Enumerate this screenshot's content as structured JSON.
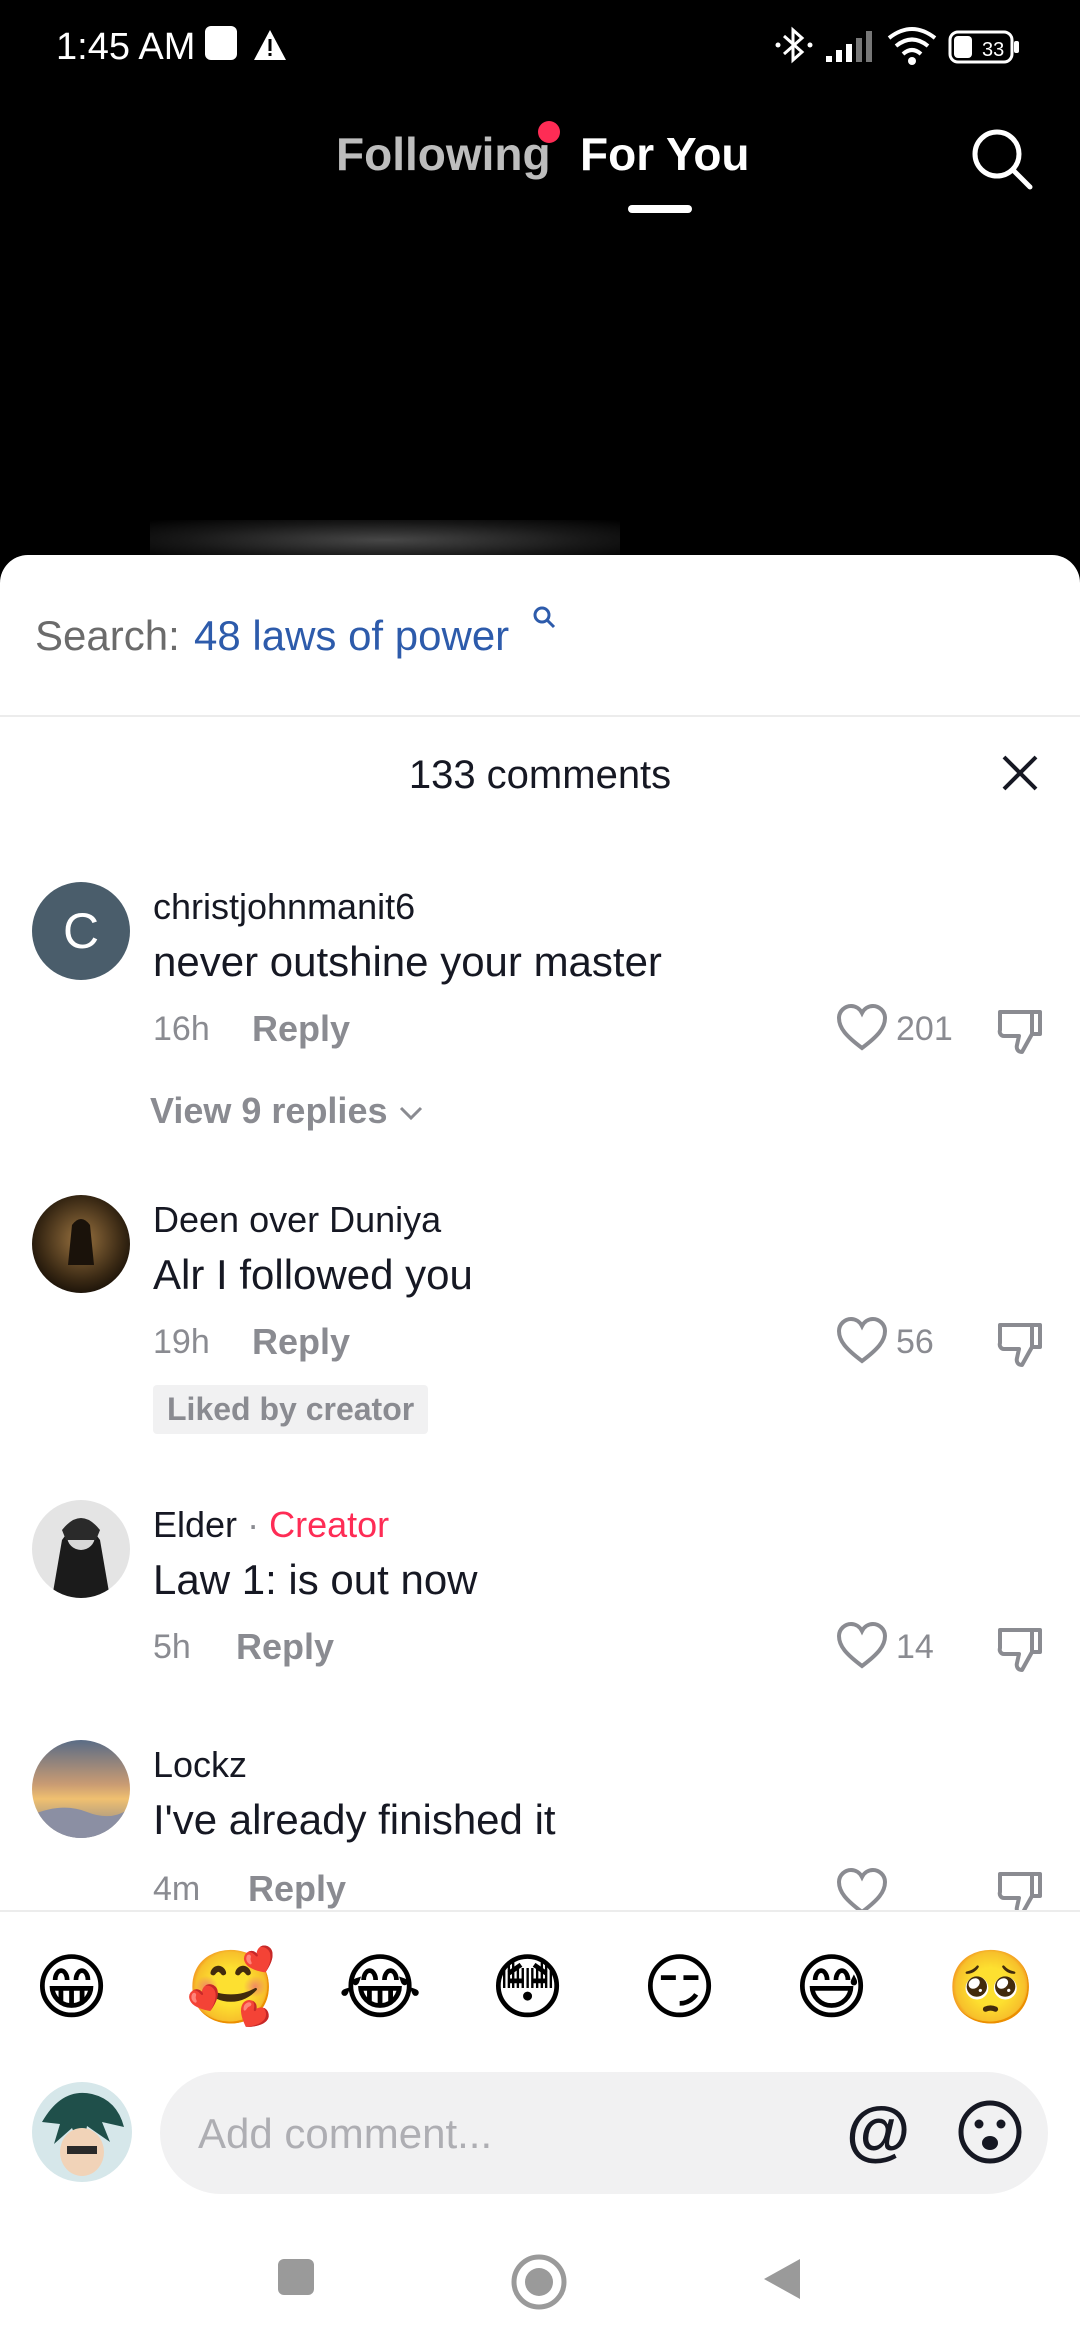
{
  "status_bar": {
    "time": "1:45 AM",
    "battery": "33"
  },
  "top_nav": {
    "tabs": [
      {
        "label": "Following"
      },
      {
        "label": "For You"
      }
    ]
  },
  "search": {
    "label": "Search:",
    "query": "48 laws of power"
  },
  "comments_header": {
    "count_label": "133 comments"
  },
  "comments": [
    {
      "avatar_letter": "C",
      "username": "christjohnmanit6",
      "text": "never outshine your master",
      "time": "16h",
      "reply": "Reply",
      "likes": "201",
      "view_replies": "View 9 replies"
    },
    {
      "username": "Deen over Duniya",
      "text": "Alr I followed you",
      "time": "19h",
      "reply": "Reply",
      "likes": "56",
      "badge": "Liked by creator"
    },
    {
      "username": "Elder",
      "separator": "·",
      "creator_label": "Creator",
      "text": "Law 1: is out now",
      "time": "5h",
      "reply": "Reply",
      "likes": "14"
    },
    {
      "username": "Lockz",
      "text": "I've already finished it",
      "time": "4m",
      "reply": "Reply"
    }
  ],
  "emoji_bar": [
    "😁",
    "🥰",
    "😂",
    "😳",
    "😏",
    "😅",
    "🥺"
  ],
  "comment_input": {
    "placeholder": "Add comment...",
    "at_symbol": "@"
  },
  "colors": {
    "accent": "#fe2c55",
    "link": "#2d5bab",
    "muted": "#8a8b91",
    "text": "#161823"
  }
}
